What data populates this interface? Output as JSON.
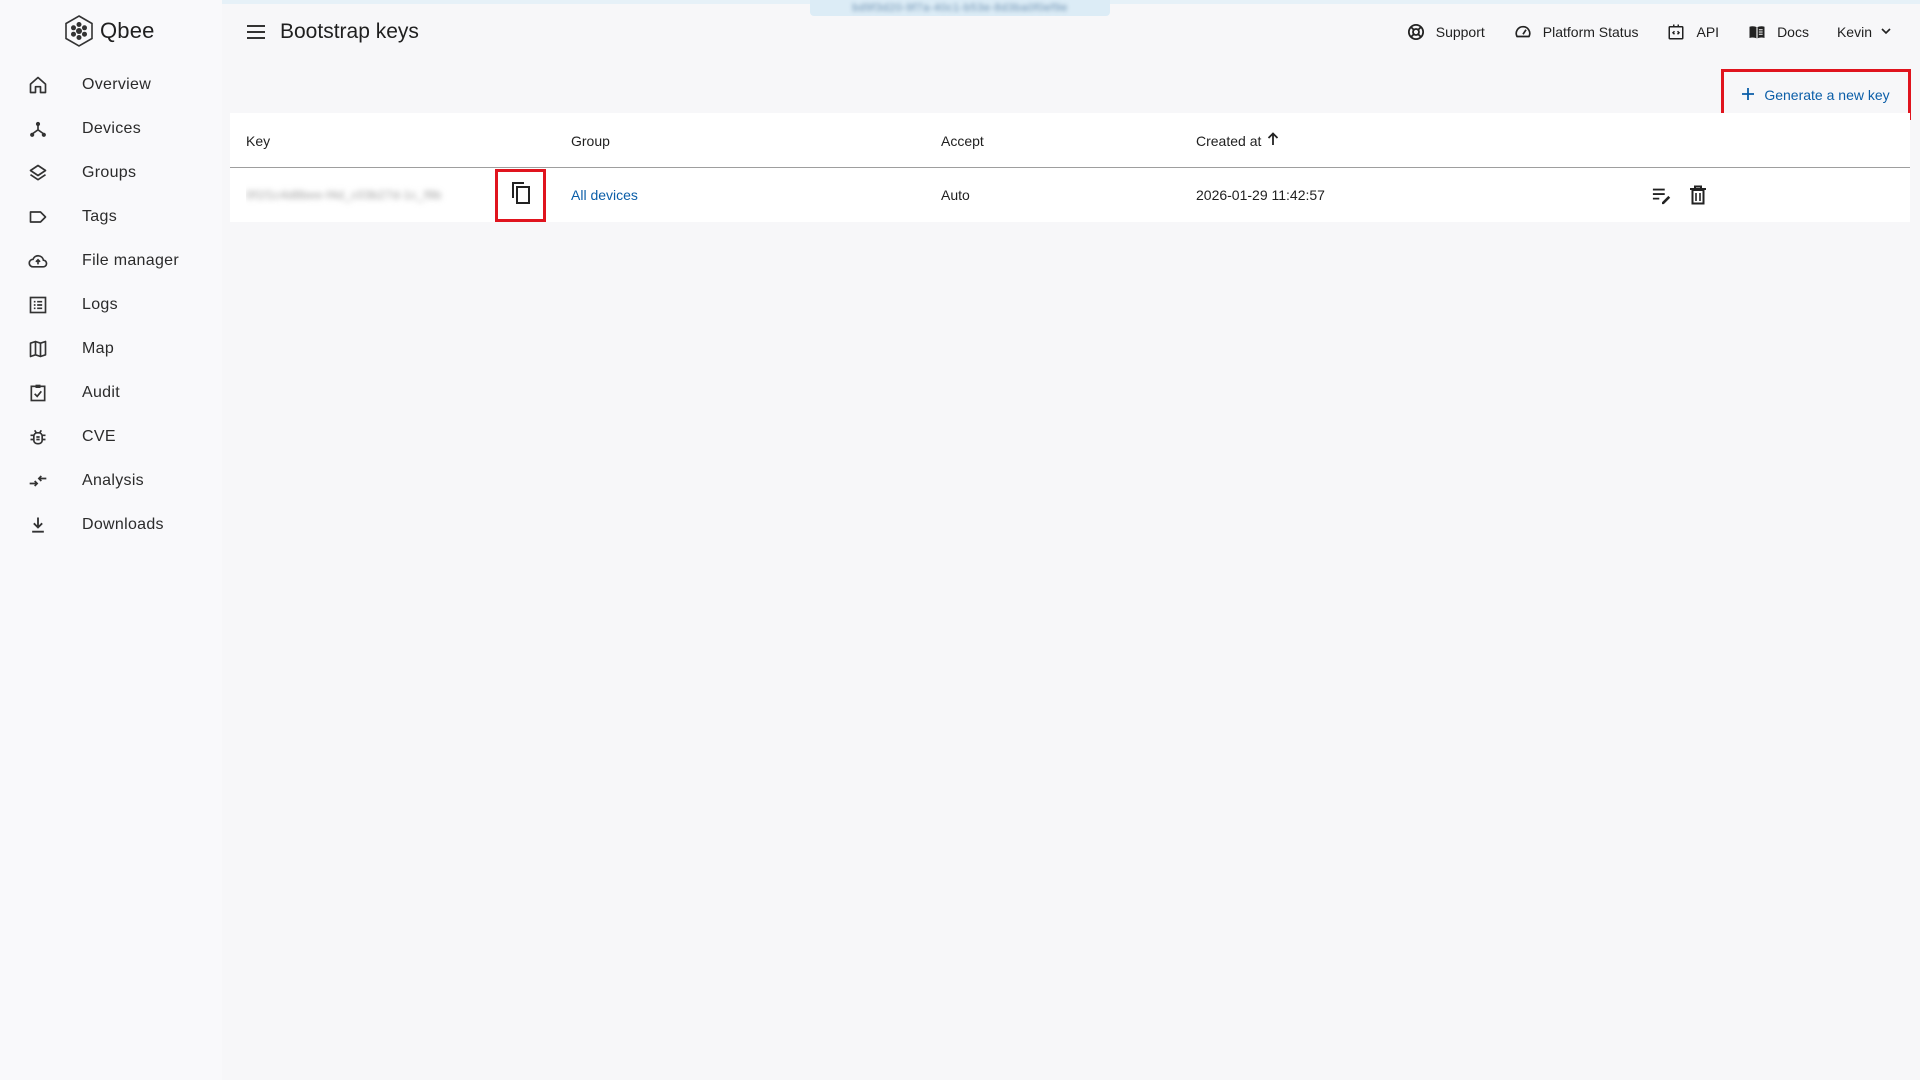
{
  "app": {
    "name": "Qbee"
  },
  "banner": {
    "text": "bd9f3d20-9f7a-40c1-b53e-8d3ba0f0ef9e"
  },
  "header": {
    "title": "Bootstrap keys",
    "links": [
      {
        "label": "Support",
        "icon": "support-icon"
      },
      {
        "label": "Platform Status",
        "icon": "gauge-icon"
      },
      {
        "label": "API",
        "icon": "api-icon"
      },
      {
        "label": "Docs",
        "icon": "book-icon"
      }
    ],
    "user": "Kevin"
  },
  "sidebar": {
    "items": [
      {
        "label": "Overview",
        "icon": "home-icon"
      },
      {
        "label": "Devices",
        "icon": "devices-icon"
      },
      {
        "label": "Groups",
        "icon": "layers-icon"
      },
      {
        "label": "Tags",
        "icon": "tag-icon"
      },
      {
        "label": "File manager",
        "icon": "cloud-upload-icon"
      },
      {
        "label": "Logs",
        "icon": "logs-icon"
      },
      {
        "label": "Map",
        "icon": "map-icon"
      },
      {
        "label": "Audit",
        "icon": "audit-icon"
      },
      {
        "label": "CVE",
        "icon": "bug-icon"
      },
      {
        "label": "Analysis",
        "icon": "compare-arrows-icon"
      },
      {
        "label": "Downloads",
        "icon": "download-icon"
      }
    ]
  },
  "actions": {
    "generate_label": "Generate a new key"
  },
  "table": {
    "headers": {
      "key": "Key",
      "group": "Group",
      "accept": "Accept",
      "created": "Created at"
    },
    "rows": [
      {
        "key": "0f1f1c4d8bee-f4d_c03b27d-1c_f9b",
        "group": "All devices",
        "accept": "Auto",
        "created": "2026-01-29 11:42:57"
      }
    ]
  },
  "colors": {
    "accent": "#0b5ea8",
    "highlight": "#e0141e",
    "background": "#f7f7f9"
  }
}
